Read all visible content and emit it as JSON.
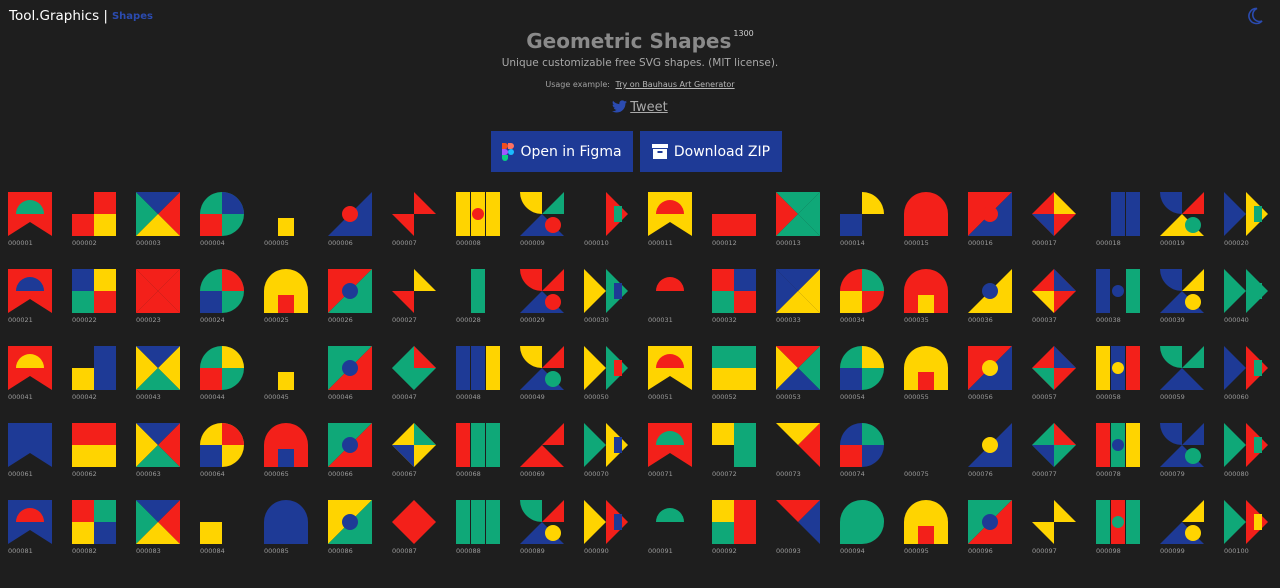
{
  "header": {
    "brand": "Tool.Graphics |",
    "section": "Shapes",
    "theme_icon": "moon-icon"
  },
  "hero": {
    "title": "Geometric Shapes",
    "count": "1300",
    "subtitle": "Unique customizable free SVG shapes. (MIT license).",
    "usage_label": "Usage example:",
    "usage_link": "Try on Bauhaus Art Generator",
    "tweet_label": "Tweet",
    "tweet_icon": "twitter-icon"
  },
  "actions": {
    "figma_label": "Open in Figma",
    "figma_icon": "figma-icon",
    "zip_label": "Download ZIP",
    "zip_icon": "archive-icon"
  },
  "colors": {
    "red": "#f3201a",
    "yellow": "#ffd400",
    "green": "#0fa878",
    "blue": "#1e3a96",
    "white": "#ffffff",
    "bg": "#1e1e1e"
  },
  "shapes": [
    {
      "id": "000001",
      "c": [
        "R",
        "G",
        "R",
        "R"
      ]
    },
    {
      "id": "000002",
      "c": [
        "X",
        "R",
        "R",
        "Y"
      ]
    },
    {
      "id": "000003",
      "c": [
        "G",
        "R",
        "B",
        "Y"
      ]
    },
    {
      "id": "000004",
      "c": [
        "G",
        "B",
        "R",
        "Y"
      ]
    },
    {
      "id": "000005",
      "c": [
        "X",
        "Y",
        "Y",
        "B"
      ]
    },
    {
      "id": "000006",
      "c": [
        "X",
        "B",
        "R",
        "B"
      ]
    },
    {
      "id": "000007",
      "c": [
        "X",
        "R",
        "R",
        "R"
      ]
    },
    {
      "id": "000008",
      "c": [
        "Y",
        "Y",
        "Y",
        "R"
      ]
    },
    {
      "id": "000009",
      "c": [
        "Y",
        "G",
        "B",
        "R"
      ]
    },
    {
      "id": "000010",
      "c": [
        "X",
        "R",
        "G",
        "R"
      ]
    },
    {
      "id": "000011",
      "c": [
        "Y",
        "R",
        "Y",
        "Y"
      ]
    },
    {
      "id": "000012",
      "c": [
        "X",
        "X",
        "R",
        "R"
      ]
    },
    {
      "id": "000013",
      "c": [
        "R",
        "G",
        "G",
        "G"
      ]
    },
    {
      "id": "000014",
      "c": [
        "X",
        "Y",
        "B",
        "Y"
      ]
    },
    {
      "id": "000015",
      "c": [
        "R",
        "G",
        "X",
        "R"
      ]
    },
    {
      "id": "000016",
      "c": [
        "R",
        "B",
        "R",
        "Y"
      ]
    },
    {
      "id": "000017",
      "c": [
        "R",
        "Y",
        "G",
        "B"
      ]
    },
    {
      "id": "000018",
      "c": [
        "X",
        "B",
        "B",
        "B"
      ]
    },
    {
      "id": "000019",
      "c": [
        "B",
        "R",
        "Y",
        "G"
      ]
    },
    {
      "id": "000020",
      "c": [
        "B",
        "Y",
        "G",
        "R"
      ]
    },
    {
      "id": "000021",
      "c": [
        "R",
        "B",
        "Y",
        "G"
      ]
    },
    {
      "id": "000022",
      "c": [
        "B",
        "Y",
        "G",
        "R"
      ]
    },
    {
      "id": "000023",
      "c": [
        "R",
        "R",
        "R",
        "R"
      ]
    },
    {
      "id": "000024",
      "c": [
        "G",
        "R",
        "B",
        "Y"
      ]
    },
    {
      "id": "000025",
      "c": [
        "Y",
        "G",
        "R",
        "B"
      ]
    },
    {
      "id": "000026",
      "c": [
        "R",
        "G",
        "B",
        "Y"
      ]
    },
    {
      "id": "000027",
      "c": [
        "X",
        "Y",
        "B",
        "R"
      ]
    },
    {
      "id": "000028",
      "c": [
        "X",
        "G",
        "X",
        "G"
      ]
    },
    {
      "id": "000029",
      "c": [
        "R",
        "R",
        "B",
        "R"
      ]
    },
    {
      "id": "000030",
      "c": [
        "Y",
        "G",
        "B",
        "R"
      ]
    },
    {
      "id": "000031",
      "c": [
        "X",
        "R",
        "R",
        "Y"
      ]
    },
    {
      "id": "000032",
      "c": [
        "R",
        "B",
        "G",
        "R"
      ]
    },
    {
      "id": "000033",
      "c": [
        "B",
        "Y",
        "B",
        "Y"
      ]
    },
    {
      "id": "000034",
      "c": [
        "R",
        "G",
        "Y",
        "B"
      ]
    },
    {
      "id": "000035",
      "c": [
        "R",
        "G",
        "Y",
        "B"
      ]
    },
    {
      "id": "000036",
      "c": [
        "X",
        "Y",
        "B",
        "G"
      ]
    },
    {
      "id": "000037",
      "c": [
        "R",
        "B",
        "G",
        "Y"
      ]
    },
    {
      "id": "000038",
      "c": [
        "B",
        "X",
        "G",
        "B"
      ]
    },
    {
      "id": "000039",
      "c": [
        "B",
        "Y",
        "B",
        "Y"
      ]
    },
    {
      "id": "000040",
      "c": [
        "G",
        "G",
        "G",
        "X"
      ]
    },
    {
      "id": "000041",
      "c": [
        "R",
        "Y",
        "G",
        "B"
      ]
    },
    {
      "id": "000042",
      "c": [
        "X",
        "B",
        "Y",
        "B"
      ]
    },
    {
      "id": "000043",
      "c": [
        "Y",
        "Y",
        "B",
        "G"
      ]
    },
    {
      "id": "000044",
      "c": [
        "G",
        "Y",
        "R",
        "G"
      ]
    },
    {
      "id": "000045",
      "c": [
        "X",
        "B",
        "Y",
        "B"
      ]
    },
    {
      "id": "000046",
      "c": [
        "G",
        "R",
        "B",
        "G"
      ]
    },
    {
      "id": "000047",
      "c": [
        "G",
        "R",
        "G",
        "G"
      ]
    },
    {
      "id": "000048",
      "c": [
        "B",
        "B",
        "Y",
        "B"
      ]
    },
    {
      "id": "000049",
      "c": [
        "Y",
        "R",
        "B",
        "G"
      ]
    },
    {
      "id": "000050",
      "c": [
        "Y",
        "G",
        "R",
        "B"
      ]
    },
    {
      "id": "000051",
      "c": [
        "Y",
        "R",
        "B",
        "R"
      ]
    },
    {
      "id": "000052",
      "c": [
        "G",
        "G",
        "Y",
        "Y"
      ]
    },
    {
      "id": "000053",
      "c": [
        "Y",
        "G",
        "R",
        "B"
      ]
    },
    {
      "id": "000054",
      "c": [
        "G",
        "Y",
        "B",
        "R"
      ]
    },
    {
      "id": "000055",
      "c": [
        "Y",
        "B",
        "R",
        "Y"
      ]
    },
    {
      "id": "000056",
      "c": [
        "R",
        "B",
        "Y",
        "X"
      ]
    },
    {
      "id": "000057",
      "c": [
        "R",
        "B",
        "Y",
        "G"
      ]
    },
    {
      "id": "000058",
      "c": [
        "Y",
        "B",
        "R",
        "Y"
      ]
    },
    {
      "id": "000059",
      "c": [
        "G",
        "G",
        "B",
        "X"
      ]
    },
    {
      "id": "000060",
      "c": [
        "B",
        "R",
        "G",
        "Y"
      ]
    },
    {
      "id": "000061",
      "c": [
        "B",
        "B",
        "R",
        "R"
      ]
    },
    {
      "id": "000062",
      "c": [
        "R",
        "R",
        "Y",
        "Y"
      ]
    },
    {
      "id": "000063",
      "c": [
        "Y",
        "R",
        "B",
        "G"
      ]
    },
    {
      "id": "000064",
      "c": [
        "Y",
        "R",
        "B",
        "Y"
      ]
    },
    {
      "id": "000065",
      "c": [
        "R",
        "Y",
        "B",
        "G"
      ]
    },
    {
      "id": "000066",
      "c": [
        "G",
        "R",
        "B",
        "Y"
      ]
    },
    {
      "id": "000067",
      "c": [
        "Y",
        "G",
        "R",
        "B"
      ]
    },
    {
      "id": "000068",
      "c": [
        "R",
        "G",
        "G",
        "G"
      ]
    },
    {
      "id": "000069",
      "c": [
        "X",
        "R",
        "R",
        "X"
      ]
    },
    {
      "id": "000070",
      "c": [
        "G",
        "Y",
        "B",
        "R"
      ]
    },
    {
      "id": "000071",
      "c": [
        "R",
        "G",
        "X",
        "G"
      ]
    },
    {
      "id": "000072",
      "c": [
        "Y",
        "G",
        "X",
        "G"
      ]
    },
    {
      "id": "000073",
      "c": [
        "X",
        "R",
        "Y",
        "X"
      ]
    },
    {
      "id": "000074",
      "c": [
        "B",
        "G",
        "R",
        "Y"
      ]
    },
    {
      "id": "000075",
      "c": [
        "X",
        "B",
        "X",
        "R"
      ]
    },
    {
      "id": "000076",
      "c": [
        "X",
        "B",
        "Y",
        "Y"
      ]
    },
    {
      "id": "000077",
      "c": [
        "G",
        "R",
        "Y",
        "B"
      ]
    },
    {
      "id": "000078",
      "c": [
        "R",
        "G",
        "Y",
        "B"
      ]
    },
    {
      "id": "000079",
      "c": [
        "B",
        "B",
        "B",
        "G"
      ]
    },
    {
      "id": "000080",
      "c": [
        "G",
        "R",
        "G",
        "G"
      ]
    },
    {
      "id": "000081",
      "c": [
        "B",
        "R",
        "Y",
        "G"
      ]
    },
    {
      "id": "000082",
      "c": [
        "R",
        "G",
        "Y",
        "B"
      ]
    },
    {
      "id": "000083",
      "c": [
        "G",
        "R",
        "B",
        "Y"
      ]
    },
    {
      "id": "000084",
      "c": [
        "X",
        "X",
        "Y",
        "R"
      ]
    },
    {
      "id": "000085",
      "c": [
        "B",
        "R",
        "B",
        "B"
      ]
    },
    {
      "id": "000086",
      "c": [
        "Y",
        "G",
        "B",
        "R"
      ]
    },
    {
      "id": "000087",
      "c": [
        "R",
        "X",
        "Y",
        "X"
      ]
    },
    {
      "id": "000088",
      "c": [
        "G",
        "G",
        "G",
        "G"
      ]
    },
    {
      "id": "000089",
      "c": [
        "G",
        "R",
        "B",
        "Y"
      ]
    },
    {
      "id": "000090",
      "c": [
        "Y",
        "R",
        "B",
        "G"
      ]
    },
    {
      "id": "000091",
      "c": [
        "X",
        "G",
        "Y",
        "G"
      ]
    },
    {
      "id": "000092",
      "c": [
        "Y",
        "R",
        "G",
        "R"
      ]
    },
    {
      "id": "000093",
      "c": [
        "X",
        "B",
        "R",
        "X"
      ]
    },
    {
      "id": "000094",
      "c": [
        "G",
        "G",
        "G",
        "G"
      ]
    },
    {
      "id": "000095",
      "c": [
        "Y",
        "B",
        "R",
        "G"
      ]
    },
    {
      "id": "000096",
      "c": [
        "G",
        "R",
        "B",
        "Y"
      ]
    },
    {
      "id": "000097",
      "c": [
        "X",
        "Y",
        "R",
        "Y"
      ]
    },
    {
      "id": "000098",
      "c": [
        "G",
        "R",
        "G",
        "G"
      ]
    },
    {
      "id": "000099",
      "c": [
        "X",
        "Y",
        "B",
        "Y"
      ]
    },
    {
      "id": "000100",
      "c": [
        "G",
        "R",
        "Y",
        "B"
      ]
    }
  ]
}
